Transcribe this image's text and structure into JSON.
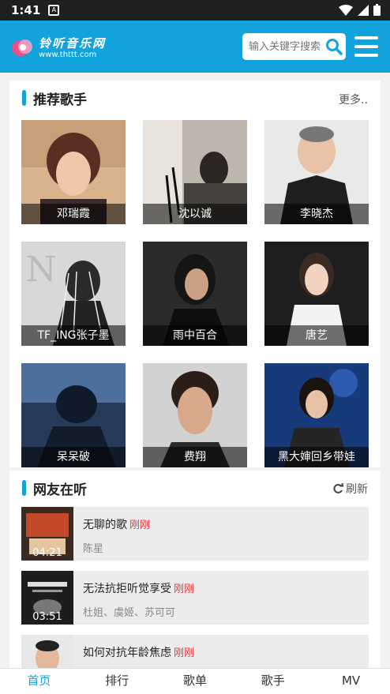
{
  "status": {
    "time": "1:41"
  },
  "header": {
    "brand": "铃听音乐网",
    "url": "www.thttt.com",
    "search_placeholder": "输入关键字搜索"
  },
  "recommend": {
    "title": "推荐歌手",
    "more": "更多..",
    "singers": [
      {
        "name": "邓瑞霞"
      },
      {
        "name": "沈以诚"
      },
      {
        "name": "李晓杰"
      },
      {
        "name": "TF_ING张子墨"
      },
      {
        "name": "雨中百合"
      },
      {
        "name": "唐艺"
      },
      {
        "name": "呆呆破"
      },
      {
        "name": "费翔"
      },
      {
        "name": "黑大婶回乡带娃"
      }
    ]
  },
  "listening": {
    "title": "网友在听",
    "refresh": "刷新",
    "songs": [
      {
        "title": "无聊的歌",
        "tag": "刚刚",
        "artist": "陈星",
        "duration": "04:21"
      },
      {
        "title": "无法抗拒听觉享受",
        "tag": "刚刚",
        "artist": "杜姐、虞姬、苏可可",
        "duration": "03:51"
      },
      {
        "title": "如何对抗年龄焦虑",
        "tag": "刚刚",
        "artist": "",
        "duration": ""
      }
    ]
  },
  "tabs": [
    {
      "label": "首页"
    },
    {
      "label": "排行"
    },
    {
      "label": "歌单"
    },
    {
      "label": "歌手"
    },
    {
      "label": "MV"
    }
  ],
  "colors": {
    "accent": "#13a3dc",
    "tag": "#e23c3c"
  }
}
